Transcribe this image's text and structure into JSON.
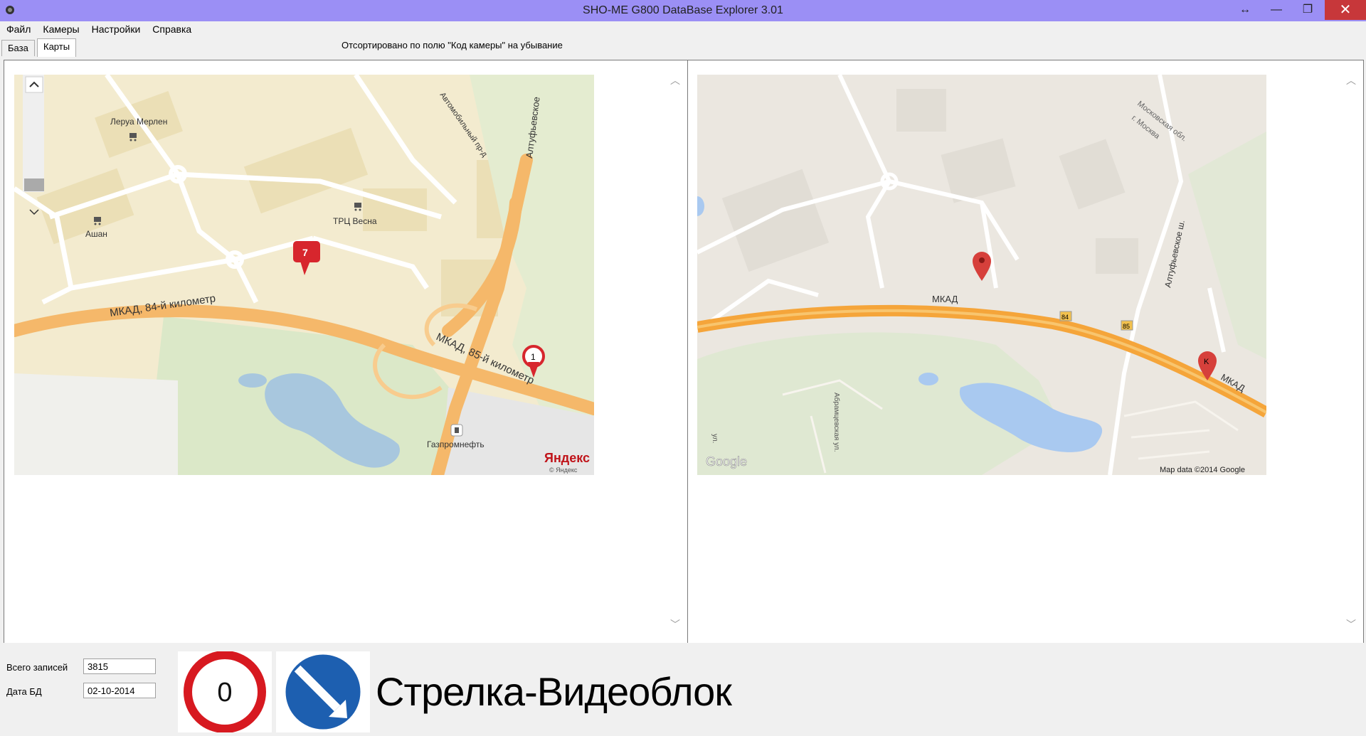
{
  "window": {
    "title": "SHO-ME G800 DataBase Explorer 3.01",
    "resize_glyph": "↔",
    "minimize_glyph": "—",
    "maximize_glyph": "❐",
    "close_glyph": "✕"
  },
  "menu": [
    {
      "label": "Файл"
    },
    {
      "label": "Камеры"
    },
    {
      "label": "Настройки"
    },
    {
      "label": "Справка"
    }
  ],
  "tabs": [
    {
      "label": "База",
      "active": false
    },
    {
      "label": "Карты",
      "active": true
    }
  ],
  "sort_info": "Отсортировано по полю \"Код камеры\" на убывание",
  "left_map": {
    "labels": {
      "leroy": "Леруа Мерлен",
      "auchan": "Ашан",
      "trc": "ТРЦ Весна",
      "altufyevskoe": "Алтуфьевское",
      "avtomob": "Автомобильный пр-д",
      "mkad84": "МКАД, 84-й километр",
      "mkad85": "МКАД, 85-й километр",
      "gazprom": "Газпромнефть",
      "brand": "Яндекс",
      "brand_small": "© Яндекс"
    },
    "markers": [
      {
        "label": "7"
      },
      {
        "label": "1"
      }
    ]
  },
  "right_map": {
    "labels": {
      "mkad": "МКАД",
      "mkad_east": "МКАД",
      "road84": "84",
      "road85": "85",
      "altuf_sh": "Алтуфьевское ш.",
      "mosobl": "Московская обл.",
      "moscow": "г. Москва",
      "abram": "Абрамцевская ул.",
      "ul": "ул.",
      "google": "Google",
      "mapdata": "Map data ©2014 Google"
    },
    "markers": [
      {
        "label": ""
      },
      {
        "label": "K"
      }
    ]
  },
  "status": {
    "total_label": "Всего записей",
    "total_value": "3815",
    "date_label": "Дата БД",
    "date_value": "02-10-2014",
    "speed_limit": "0",
    "camera_name": "Стрелка-Видеоблок"
  },
  "colors": {
    "titlebar": "#9b8ff5",
    "close": "#c7373a",
    "mkad_orange": "#f5a53a",
    "sign_red": "#d71920",
    "sign_blue": "#1d5fb0"
  }
}
